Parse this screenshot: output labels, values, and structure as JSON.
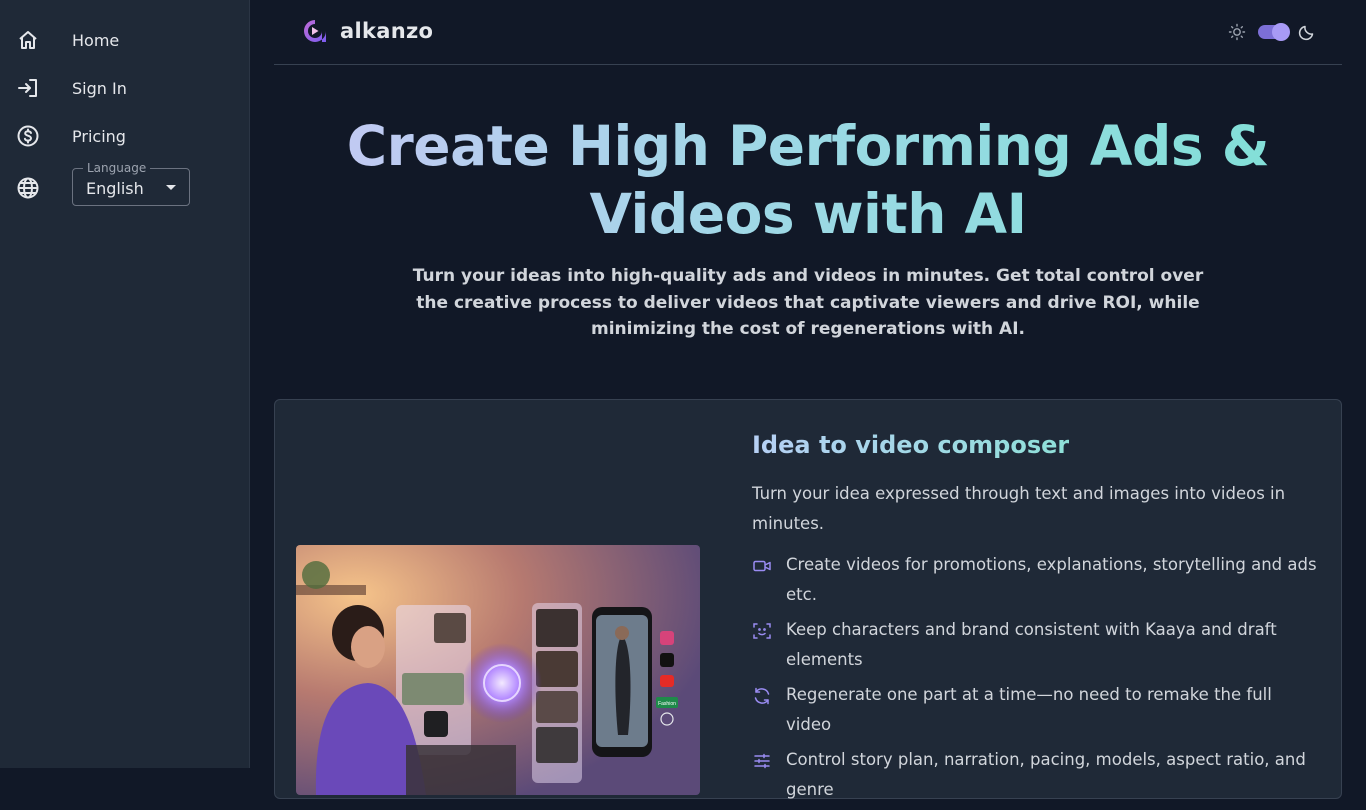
{
  "sidebar": {
    "items": [
      {
        "label": "Home",
        "icon": "home-icon"
      },
      {
        "label": "Sign In",
        "icon": "sign-in-icon"
      },
      {
        "label": "Pricing",
        "icon": "dollar-icon"
      }
    ],
    "language": {
      "legend": "Language",
      "value": "English",
      "icon": "globe-icon"
    }
  },
  "header": {
    "brand": "alkanzo",
    "theme": {
      "light_icon": "sun-icon",
      "dark_icon": "moon-icon",
      "mode": "dark"
    }
  },
  "hero": {
    "title": "Create High Performing Ads & Videos with AI",
    "subtitle": "Turn your ideas into high-quality ads and videos in minutes. Get total control over the creative process to deliver videos that captivate viewers and drive ROI, while minimizing the cost of regenerations with AI."
  },
  "feature_card": {
    "title": "Idea to video composer",
    "description": "Turn your idea expressed through text and images into videos in minutes.",
    "features": [
      {
        "icon": "video-icon",
        "text": "Create videos for promotions, explanations, storytelling and ads etc."
      },
      {
        "icon": "face-scan-icon",
        "text": "Keep characters and brand consistent with Kaaya and draft elements"
      },
      {
        "icon": "refresh-icon",
        "text": "Regenerate one part at a time—no need to remake the full video"
      },
      {
        "icon": "sliders-icon",
        "text": "Control story plan, narration, pacing, models, aspect ratio, and genre"
      }
    ],
    "image_badge": "Fashion"
  },
  "colors": {
    "background": "#111827",
    "sidebar": "#1f2937",
    "accent": "#8b7cf6",
    "teal": "#7fe0d6"
  }
}
